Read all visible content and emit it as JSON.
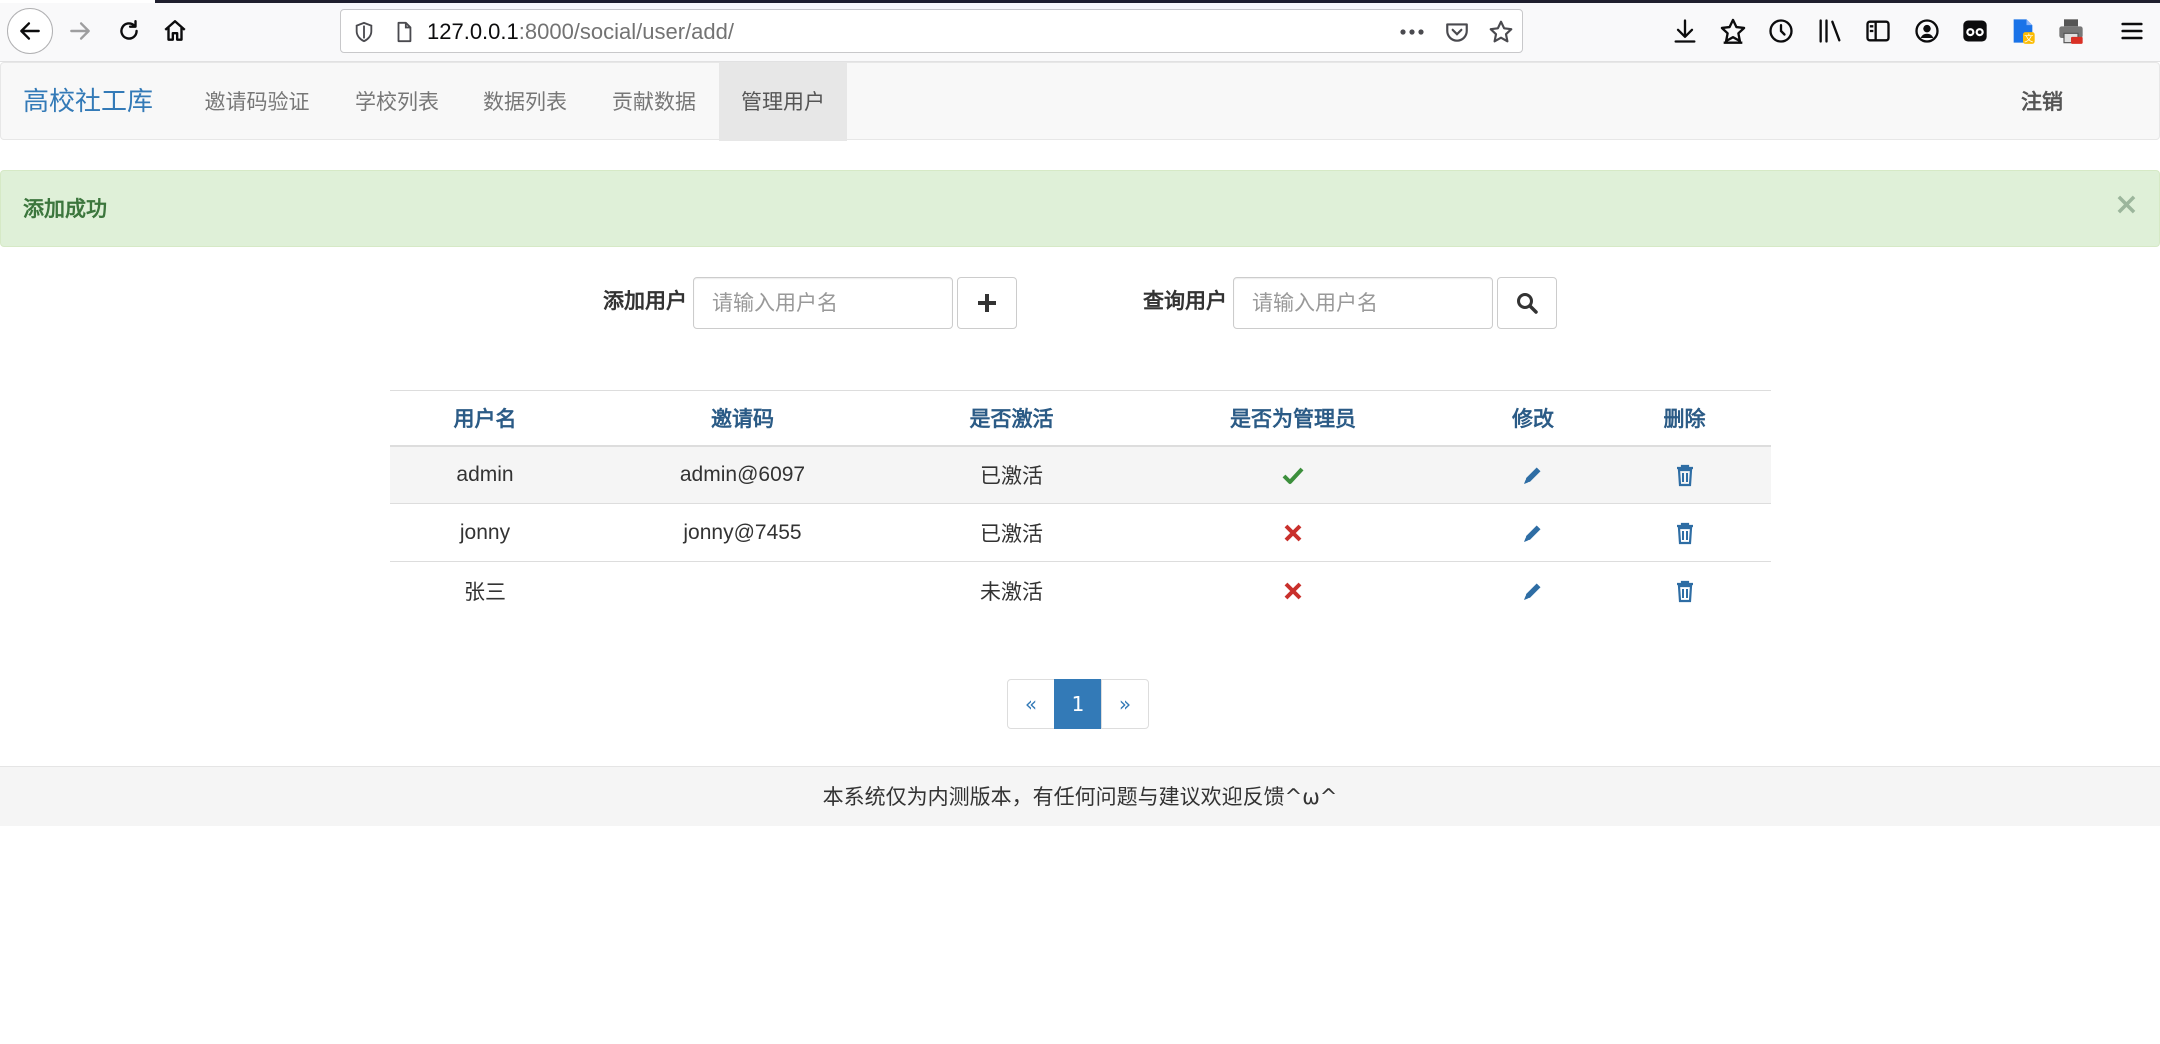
{
  "browser": {
    "url_host": "127.0.0.1",
    "url_rest": ":8000/social/user/add/"
  },
  "navbar": {
    "brand": "高校社工库",
    "items": [
      {
        "label": "邀请码验证"
      },
      {
        "label": "学校列表"
      },
      {
        "label": "数据列表"
      },
      {
        "label": "贡献数据"
      },
      {
        "label": "管理用户",
        "active": true
      }
    ],
    "logout": "注销"
  },
  "alert": {
    "message": "添加成功",
    "close": "×"
  },
  "forms": {
    "add_label": "添加用户",
    "add_placeholder": "请输入用户名",
    "query_label": "查询用户",
    "query_placeholder": "请输入用户名"
  },
  "table": {
    "headers": [
      "用户名",
      "邀请码",
      "是否激活",
      "是否为管理员",
      "修改",
      "删除"
    ],
    "rows": [
      {
        "username": "admin",
        "invite_code": "admin@6097",
        "status": "已激活",
        "is_admin": "check-icon"
      },
      {
        "username": "jonny",
        "invite_code": "jonny@7455",
        "status": "已激活",
        "is_admin": "cross-icon"
      },
      {
        "username": "张三",
        "invite_code": "",
        "status": "未激活",
        "is_admin": "cross-icon"
      }
    ]
  },
  "pagination": {
    "prev": "«",
    "current": "1",
    "next": "»"
  },
  "footer": {
    "text": "本系统仅为内测版本，有任何问题与建议欢迎反馈^ω^"
  },
  "colors": {
    "brand": "#337ab7",
    "success_bg": "#dff0d8",
    "success_text": "#3c763d",
    "check": "#3c8f3c",
    "cross": "#c9302c"
  }
}
